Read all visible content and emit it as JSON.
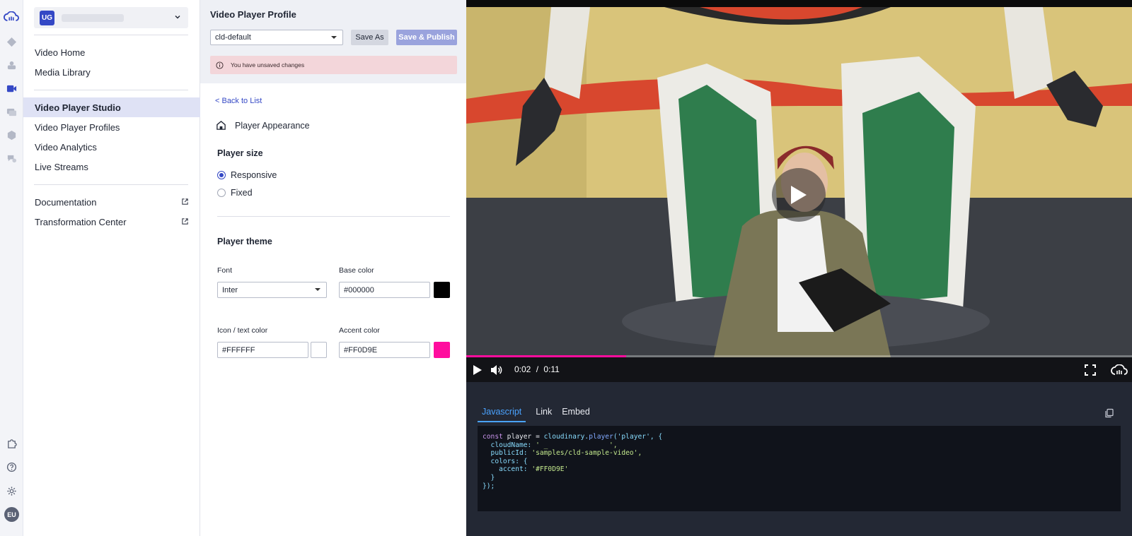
{
  "org": {
    "badge": "UG"
  },
  "nav": {
    "items": [
      {
        "label": "Video Home"
      },
      {
        "label": "Media Library"
      },
      {
        "label": "Video Player Studio"
      },
      {
        "label": "Video Player Profiles"
      },
      {
        "label": "Video Analytics"
      },
      {
        "label": "Live Streams"
      },
      {
        "label": "Documentation"
      },
      {
        "label": "Transformation Center"
      }
    ]
  },
  "user": {
    "initials": "EU"
  },
  "profile": {
    "title": "Video Player Profile",
    "selected": "cld-default",
    "save_as": "Save As",
    "save_publish": "Save & Publish",
    "alert": "You have unsaved changes"
  },
  "editor": {
    "back": "< Back to List",
    "appearance": "Player Appearance",
    "size_title": "Player size",
    "size_options": [
      "Responsive",
      "Fixed"
    ],
    "size_selected": "Responsive",
    "theme_title": "Player theme",
    "font_label": "Font",
    "font_value": "Inter",
    "base_color_label": "Base color",
    "base_color_value": "#000000",
    "icon_color_label": "Icon / text color",
    "icon_color_value": "#FFFFFF",
    "accent_color_label": "Accent color",
    "accent_color_value": "#FF0D9E"
  },
  "player": {
    "current_time": "0:02",
    "separator": "/",
    "duration": "0:11",
    "progress": 0.24
  },
  "code": {
    "tabs": [
      "Javascript",
      "Link",
      "Embed"
    ],
    "active_tab": "Javascript",
    "line1_kw": "const",
    "line1_var": " player = ",
    "line1_obj": "cloudinary.",
    "line1_fn": "player",
    "line1_args": "('player', {",
    "line2_key": "  cloudName: ",
    "line2_val": "' _               ',",
    "line3_key": "  publicId: ",
    "line3_val": "'samples/cld-sample-video',",
    "line4": "  colors: {",
    "line5_key": "    accent: ",
    "line5_val": "'#FF0D9E'",
    "line6": "  }",
    "line7": "});"
  },
  "colors": {
    "accent": "#FF0D9E",
    "brand": "#3448C5",
    "base": "#000000",
    "icon_text": "#FFFFFF"
  }
}
